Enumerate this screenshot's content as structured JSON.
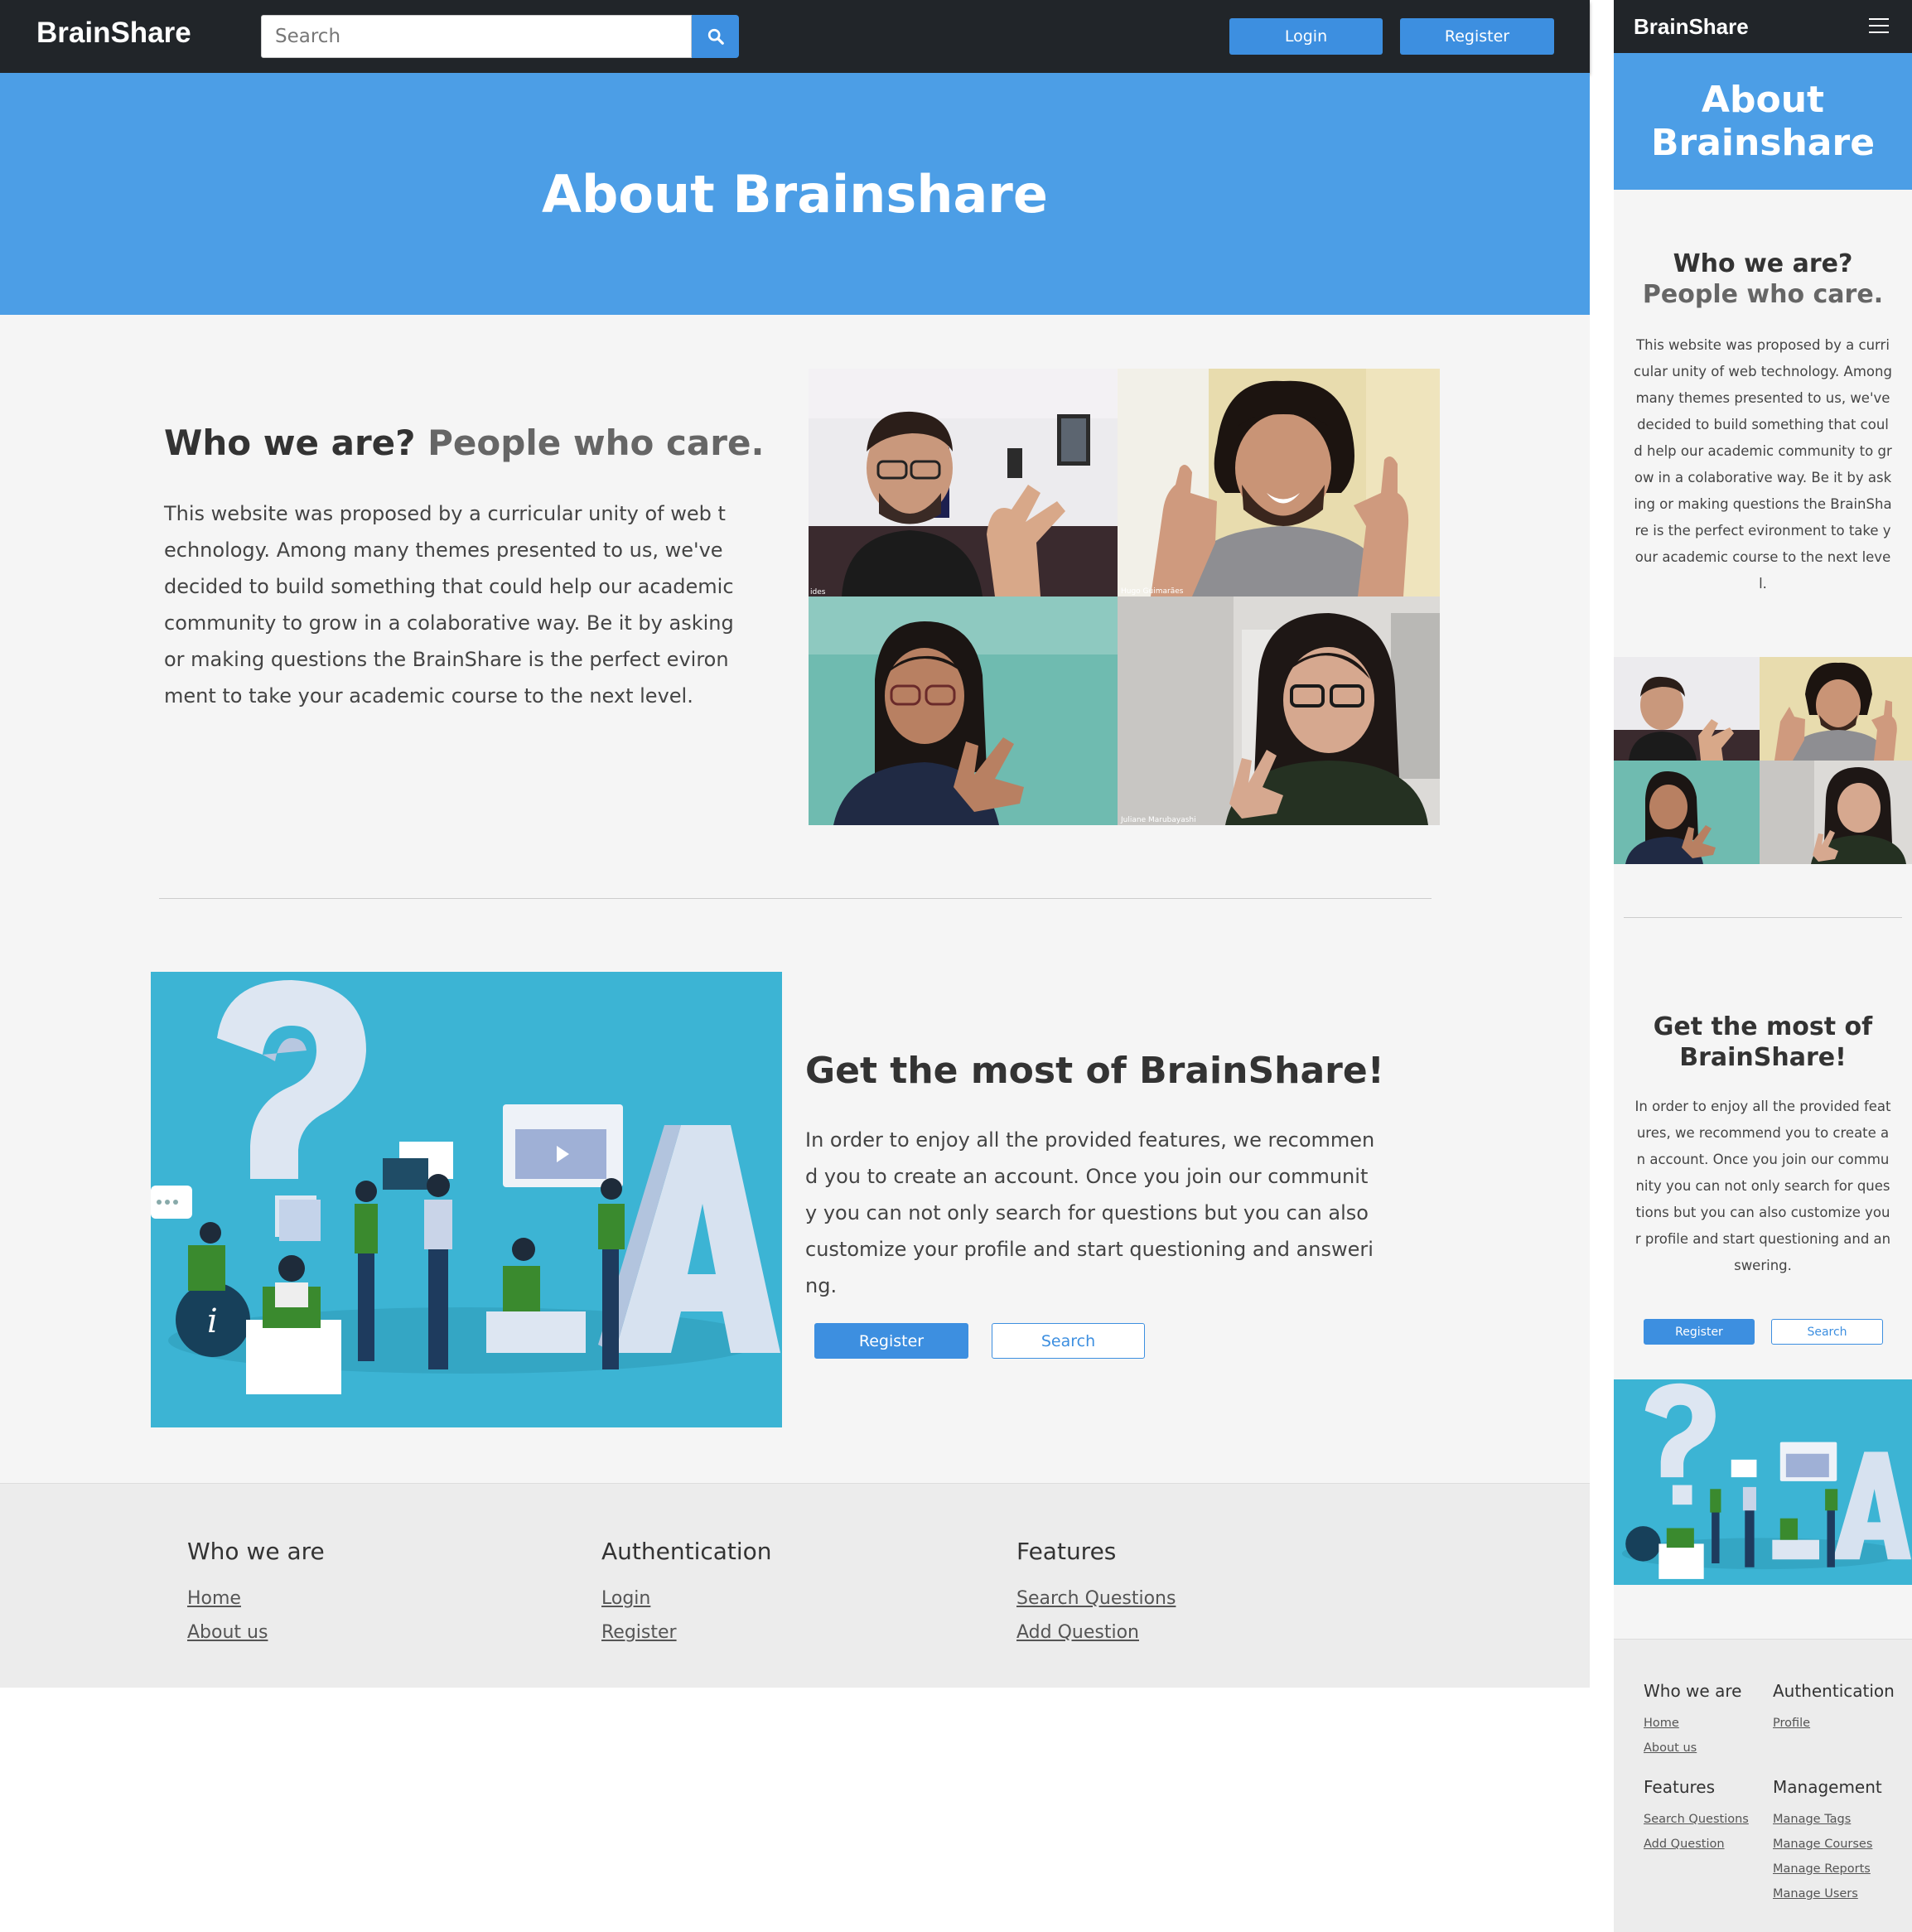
{
  "app": {
    "brand": "BrainShare"
  },
  "header": {
    "search_placeholder": "Search",
    "login_label": "Login",
    "register_label": "Register"
  },
  "hero": {
    "title": "About Brainshare"
  },
  "who": {
    "heading": "Who we are?",
    "heading_accent": "People who care.",
    "body": "This website was proposed by a curricular unity of web technology. Among many themes presented to us, we've decided to build something that could help our academic community to grow in a colaborative way. Be it by asking or making questions the BrainShare is the perfect evironment to take your academic course to the next level."
  },
  "team_photo": {
    "captions": [
      "ides",
      "Hugo Guimarães",
      "",
      "Juliane Marubayashi"
    ]
  },
  "get_most": {
    "heading": "Get the most of BrainShare!",
    "body": "In order to enjoy all the provided features, we recommend you to create an account. Once you join our community you can not only search for questions but you can also customize your profile and start questioning and answering.",
    "register_label": "Register",
    "search_label": "Search"
  },
  "footer": {
    "who": {
      "title": "Who we are",
      "links": [
        "Home",
        "About us"
      ]
    },
    "auth": {
      "title": "Authentication",
      "links": [
        "Login",
        "Register"
      ]
    },
    "features": {
      "title": "Features",
      "links": [
        "Search Questions",
        "Add Question"
      ]
    }
  },
  "mobile_footer": {
    "who": {
      "title": "Who we are",
      "links": [
        "Home",
        "About us"
      ]
    },
    "auth": {
      "title": "Authentication",
      "links": [
        "Profile"
      ]
    },
    "features": {
      "title": "Features",
      "links": [
        "Search Questions",
        "Add Question"
      ]
    },
    "management": {
      "title": "Management",
      "links": [
        "Manage Tags",
        "Manage Courses",
        "Manage Reports",
        "Manage Users"
      ]
    }
  },
  "colors": {
    "navbar": "#212529",
    "primary": "#3d8fe0",
    "hero": "#4c9ee6",
    "illustration_bg": "#3cb4d4",
    "page_bg": "#f5f5f5",
    "footer_bg": "#ececec"
  },
  "icons": {
    "search_button": "search-icon",
    "mobile_menu": "hamburger-menu-icon"
  }
}
